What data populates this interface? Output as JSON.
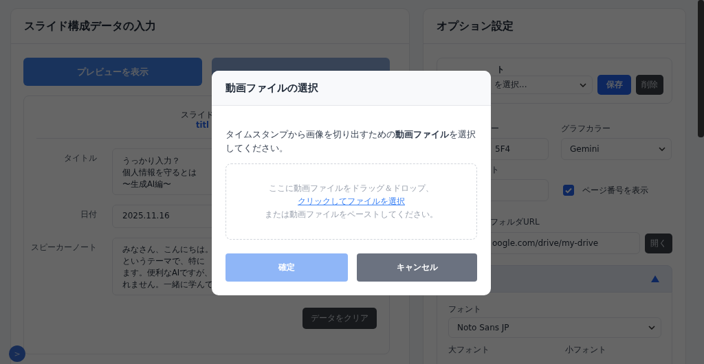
{
  "input_panel": {
    "title": "スライド構成データの入力",
    "preview_button": "プレビューを表示",
    "preview": {
      "label": "スライド",
      "link": "titl"
    },
    "fields": [
      {
        "label": "タイトル",
        "kind": "textarea",
        "lines": [
          "うっかり入力？",
          "個人情報を守るとは",
          "〜生成AI編〜"
        ]
      },
      {
        "label": "日付",
        "kind": "input",
        "value": "2025.11.16"
      },
      {
        "label": "スピーカーノート",
        "kind": "textarea",
        "lines": [
          "みなさん、こんにちは。",
          "というテーマで、特に",
          "ます。便利なAIですが、",
          "れません。一緒に学んで"
        ]
      }
    ],
    "clear_button": "データをクリア"
  },
  "sidebar_toggle": ">",
  "options": {
    "title": "オプション設定",
    "preset": {
      "label": "ト",
      "select": "を選択...",
      "save": "保存",
      "delete": "削除"
    },
    "color_label": "ー",
    "color_value": "5F4",
    "graph_label": "グラフカラー",
    "graph_value": "Gemini",
    "size_label": "ト",
    "page_number": {
      "label": "ページ番号を表示",
      "checked": true
    },
    "url_label": "フォルダURL",
    "url_value": "oogle.com/drive/my-drive",
    "open_button": "開く",
    "section": {
      "expanded": true,
      "font_label": "フォント",
      "font_value": "Noto Sans JP",
      "large_font_label": "大フォント",
      "small_font_label": "小フォント"
    }
  },
  "dialog": {
    "title": "動画ファイルの選択",
    "message": "タイムスタンプから画像を切り出すための**動画ファイル**を選択してください。",
    "drop_text": "ここに動画ファイルをドラッグ＆ドロップ、",
    "drop_link": "クリックしてファイルを選択",
    "drop_hint": "または動画ファイルをペーストしてください。",
    "confirm": {
      "label": "確定",
      "disabled": true
    },
    "cancel": "キャンセル"
  }
}
